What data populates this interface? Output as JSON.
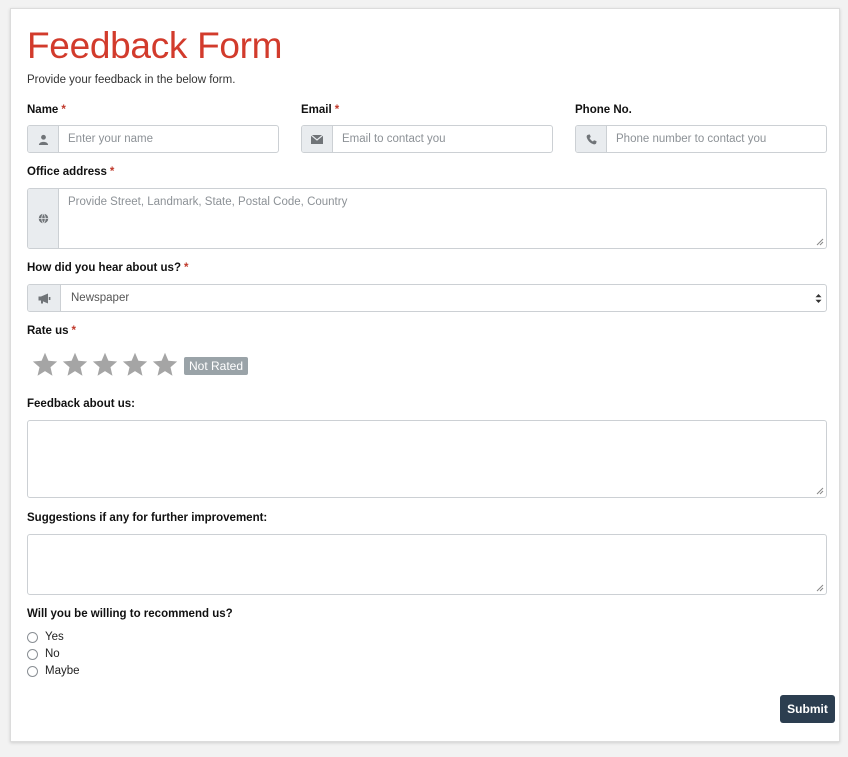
{
  "form": {
    "title": "Feedback Form",
    "subtitle": "Provide your feedback in the below form.",
    "required_mark": "*",
    "name": {
      "label": "Name",
      "placeholder": "Enter your name",
      "icon": "user-icon"
    },
    "email": {
      "label": "Email",
      "placeholder": "Email to contact you",
      "icon": "envelope-icon"
    },
    "phone": {
      "label": "Phone No.",
      "placeholder": "Phone number to contact you",
      "icon": "phone-icon"
    },
    "address": {
      "label": "Office address",
      "placeholder": "Provide Street, Landmark, State, Postal Code, Country",
      "icon": "globe-icon"
    },
    "source": {
      "label": "How did you hear about us?",
      "selected": "Newspaper",
      "icon": "bullhorn-icon"
    },
    "rating": {
      "label": "Rate us",
      "stars_total": 5,
      "stars_filled": 0,
      "badge": "Not Rated",
      "star_color": "#a5a5a5"
    },
    "feedback": {
      "label": "Feedback about us:"
    },
    "suggestions": {
      "label": "Suggestions if any for further improvement:"
    },
    "recommend": {
      "label": "Will you be willing to recommend us?",
      "options": [
        {
          "label": "Yes"
        },
        {
          "label": "No"
        },
        {
          "label": "Maybe"
        }
      ]
    },
    "submit_label": "Submit",
    "colors": {
      "title": "#d23b2c",
      "required": "#c0392b",
      "submit_bg": "#2c3e50",
      "badge_bg": "#9aa3a8"
    }
  }
}
